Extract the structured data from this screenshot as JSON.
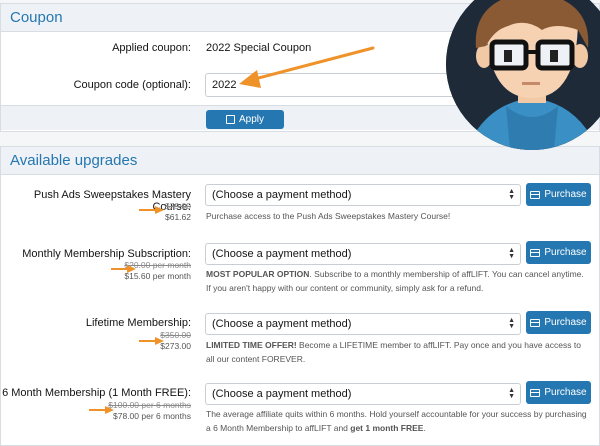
{
  "coupon": {
    "title": "Coupon",
    "applied_label": "Applied coupon:",
    "applied_value": "2022 Special Coupon",
    "code_label": "Coupon code (optional):",
    "code_value": "2022",
    "apply_label": "Apply"
  },
  "upgrades": {
    "title": "Available upgrades",
    "select_placeholder": "(Choose a payment method)",
    "purchase_label": "Purchase",
    "items": [
      {
        "name": "Push Ads Sweepstakes Mastery Course:",
        "old_price": "$79.00",
        "new_price": "$61.62",
        "desc_bold": "",
        "desc": "Purchase access to the Push Ads Sweepstakes Mastery Course!",
        "desc_bold_tail": "",
        "desc_tail": ""
      },
      {
        "name": "Monthly Membership Subscription:",
        "old_price": "$20.00 per month",
        "new_price": "$15.60 per month",
        "desc_bold": "MOST POPULAR OPTION",
        "desc": ". Subscribe to a monthly membership of affLIFT. You can cancel anytime. If you aren't happy with our content or community, simply ask for a refund.",
        "desc_bold_tail": "",
        "desc_tail": ""
      },
      {
        "name": "Lifetime Membership:",
        "old_price": "$350.00",
        "new_price": "$273.00",
        "desc_bold": "LIMITED TIME OFFER!",
        "desc": " Become a LIFETIME member to affLIFT. Pay once and you have access to all our content FOREVER.",
        "desc_bold_tail": "",
        "desc_tail": ""
      },
      {
        "name": "6 Month Membership (1 Month FREE):",
        "old_price": "$100.00 per 6 months",
        "new_price": "$78.00 per 6 months",
        "desc_bold": "",
        "desc": "The average affiliate quits within 6 months. Hold yourself accountable for your success by purchasing a 6 Month Membership to affLIFT and ",
        "desc_bold_tail": "get 1 month FREE",
        "desc_tail": "."
      }
    ]
  },
  "colors": {
    "accent": "#2577b1",
    "arrow": "#f0922a"
  },
  "icons": [
    "credit-card-icon",
    "save-icon",
    "chevron-updown-icon",
    "arrow-icon",
    "avatar"
  ]
}
